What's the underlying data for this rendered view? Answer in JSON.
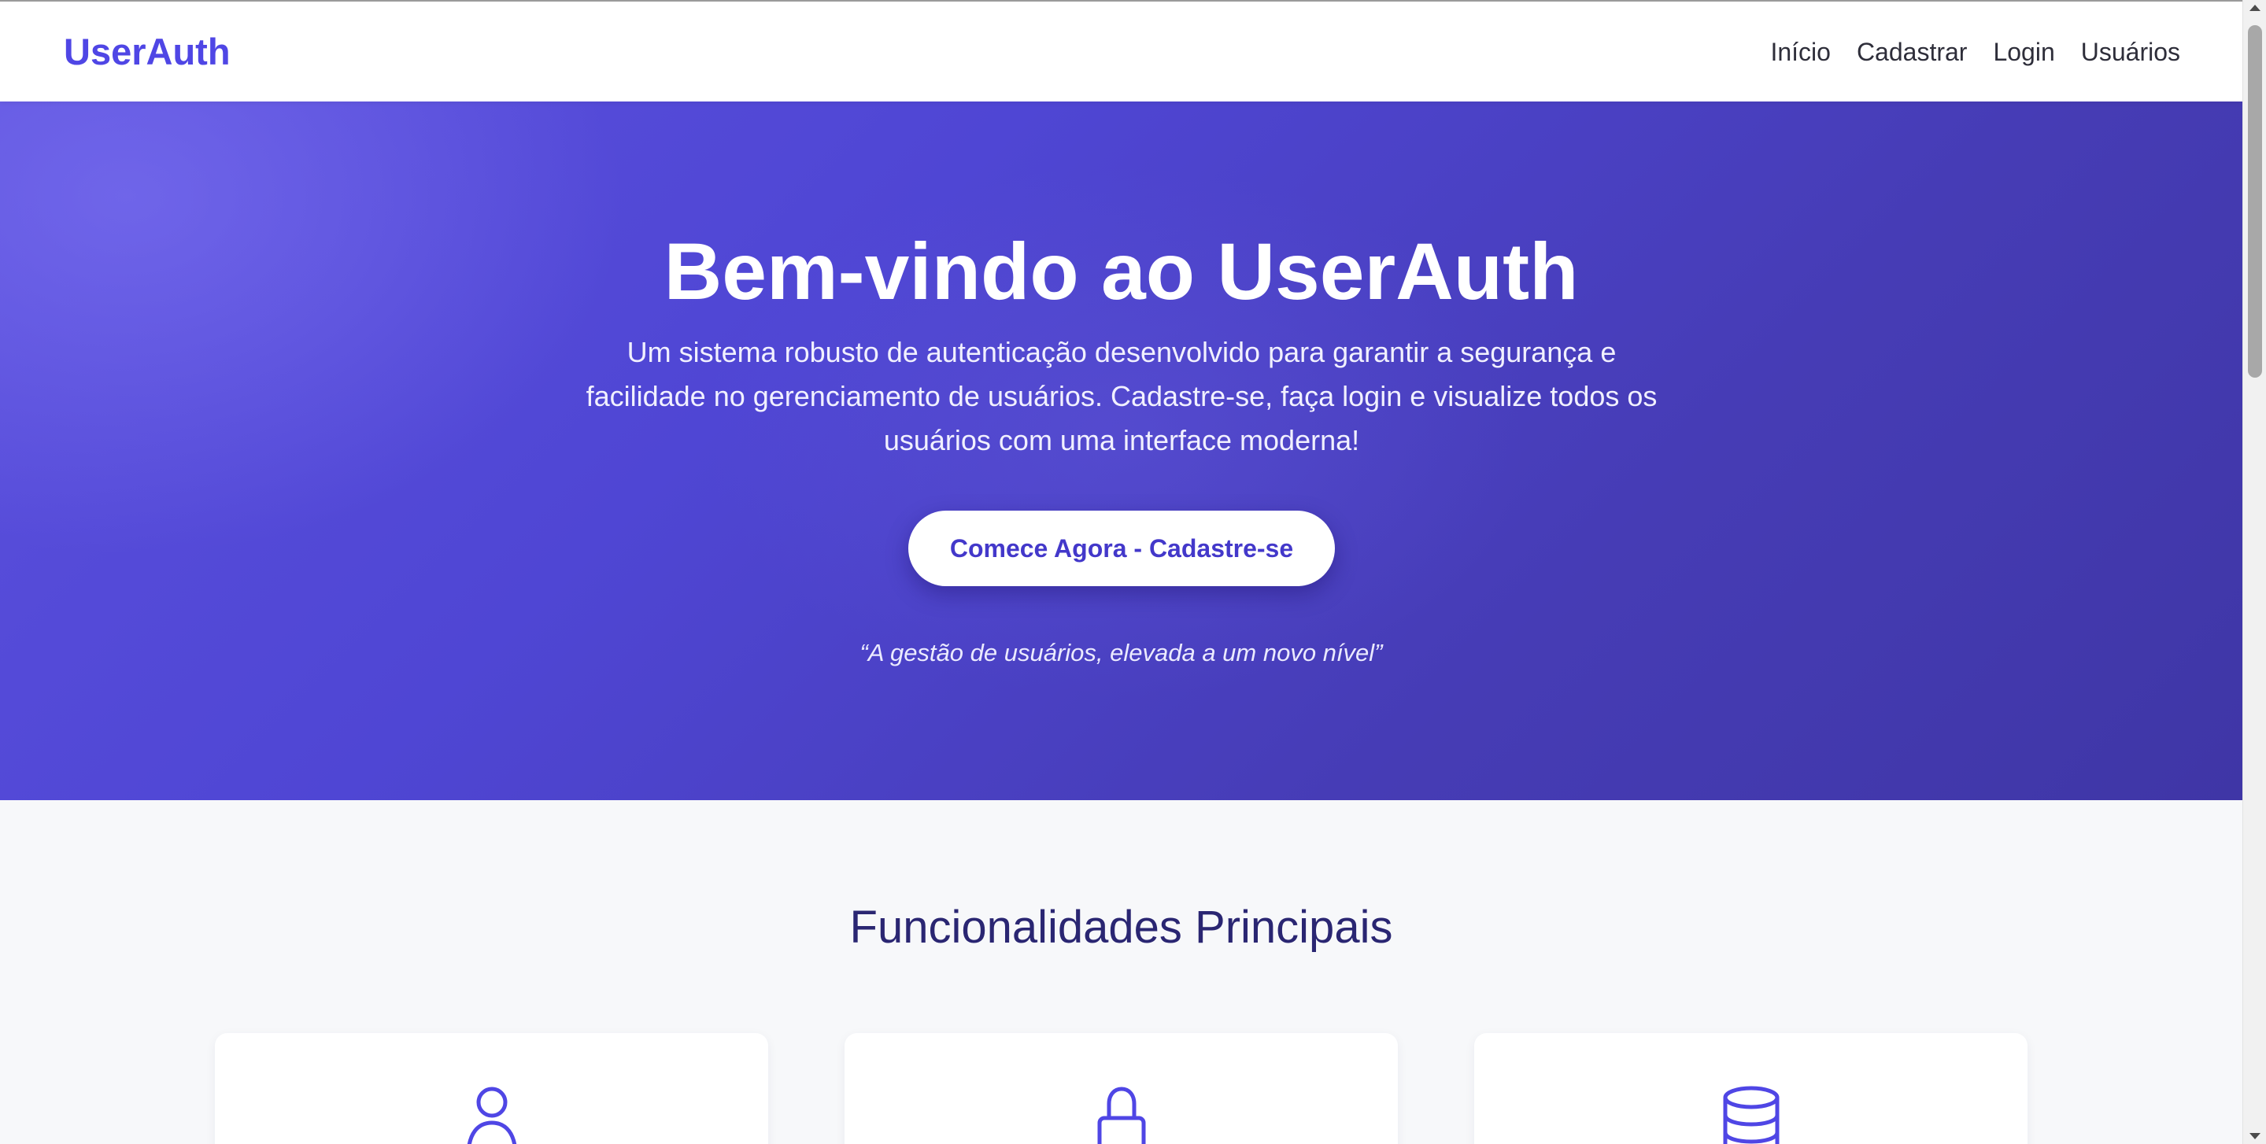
{
  "navbar": {
    "brand": "UserAuth",
    "links": [
      "Início",
      "Cadastrar",
      "Login",
      "Usuários"
    ]
  },
  "hero": {
    "title": "Bem-vindo ao UserAuth",
    "description_lines": [
      "Um sistema robusto de autenticação desenvolvido para garantir a segurança e",
      "facilidade no gerenciamento de usuários. Cadastre-se, faça login e visualize todos os",
      "usuários com uma interface moderna!"
    ],
    "cta_label": "Comece Agora - Cadastre-se",
    "tagline": "“A gestão de usuários, elevada a um novo nível”"
  },
  "features": {
    "title": "Funcionalidades Principais",
    "cards": [
      {
        "icon": "user-icon"
      },
      {
        "icon": "lock-icon"
      },
      {
        "icon": "database-icon"
      }
    ]
  },
  "colors": {
    "accent": "#4f46e5",
    "hero_start": "#5b50dd",
    "hero_end": "#3f36a6",
    "features_title": "#2a2672",
    "page_background": "#f7f8fa"
  }
}
